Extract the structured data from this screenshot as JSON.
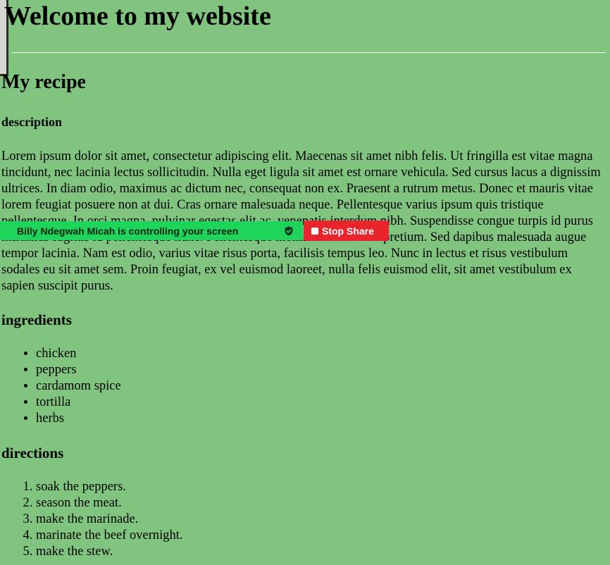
{
  "header": {
    "title": "Welcome to my website"
  },
  "recipe": {
    "title": "My recipe",
    "description_heading": "description",
    "description": "Lorem ipsum dolor sit amet, consectetur adipiscing elit. Maecenas sit amet nibh felis. Ut fringilla est vitae magna tincidunt, nec lacinia lectus sollicitudin. Nulla eget ligula sit amet est ornare vehicula. Sed cursus lacus a dignissim ultrices. In diam odio, maximus ac dictum nec, consequat non ex. Praesent a rutrum metus. Donec et mauris vitae lorem feugiat posuere non at dui. Cras ornare malesuada neque. Pellentesque varius ipsum quis tristique pellentesque. In orci magna, pulvinar egestas elit ac, venenatis interdum nibh. Suspendisse congue turpis id purus maximus sagittis id pellentesque nunc. Pellentesque mollis sodales mi ut pretium. Sed dapibus malesuada augue tempor lacinia. Nam est odio, varius vitae risus porta, facilisis tempus leo. Nunc in lectus et risus vestibulum sodales eu sit amet sem. Proin feugiat, ex vel euismod laoreet, nulla felis euismod elit, sit amet vestibulum ex sapien suscipit purus.",
    "ingredients_heading": "ingredients",
    "ingredients": [
      "chicken",
      "peppers",
      "cardamom spice",
      "tortilla",
      "herbs"
    ],
    "directions_heading": "directions",
    "directions": [
      "soak the peppers.",
      "season the meat.",
      "make the marinade.",
      "marinate the beef overnight.",
      "make the stew."
    ]
  },
  "share_banner": {
    "message": "Billy Ndegwah Micah is controlling your screen",
    "stop_label": "Stop Share",
    "bar_color": "#1ed45a",
    "stop_color": "#e8252d",
    "icon": "shield-check-icon"
  },
  "colors": {
    "page_background": "#80c47f"
  }
}
